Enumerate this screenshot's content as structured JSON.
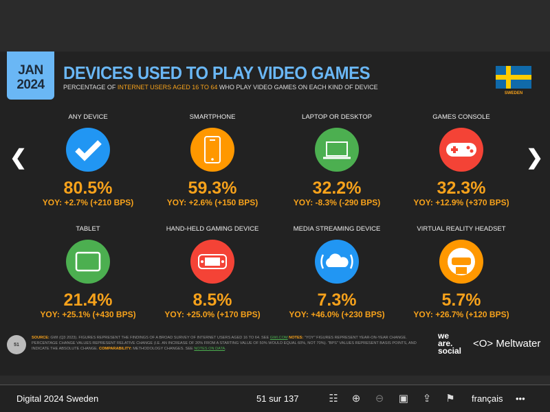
{
  "slide": {
    "date_month": "JAN",
    "date_year": "2024",
    "title": "DEVICES USED TO PLAY VIDEO GAMES",
    "subtitle_pre": "PERCENTAGE OF ",
    "subtitle_hl": "INTERNET USERS AGED 16 TO 64",
    "subtitle_post": " WHO PLAY VIDEO GAMES ON EACH KIND OF DEVICE",
    "country": "SWEDEN",
    "page_number": "51",
    "tiles": [
      {
        "label": "ANY DEVICE",
        "value": "80.5%",
        "yoy": "YOY: +2.7% (+210 BPS)",
        "icon": "check-icon",
        "color": "#2196f3"
      },
      {
        "label": "SMARTPHONE",
        "value": "59.3%",
        "yoy": "YOY: +2.6% (+150 BPS)",
        "icon": "smartphone-icon",
        "color": "#ff9800"
      },
      {
        "label": "LAPTOP OR DESKTOP",
        "value": "32.2%",
        "yoy": "YOY: -8.3% (-290 BPS)",
        "icon": "laptop-icon",
        "color": "#4caf50"
      },
      {
        "label": "GAMES CONSOLE",
        "value": "32.3%",
        "yoy": "YOY: +12.9% (+370 BPS)",
        "icon": "gamepad-icon",
        "color": "#f44336"
      },
      {
        "label": "TABLET",
        "value": "21.4%",
        "yoy": "YOY: +25.1% (+430 BPS)",
        "icon": "tablet-icon",
        "color": "#4caf50"
      },
      {
        "label": "HAND-HELD GAMING DEVICE",
        "value": "8.5%",
        "yoy": "YOY: +25.0% (+170 BPS)",
        "icon": "handheld-console-icon",
        "color": "#f44336"
      },
      {
        "label": "MEDIA STREAMING DEVICE",
        "value": "7.3%",
        "yoy": "YOY: +46.0% (+230 BPS)",
        "icon": "cloud-streaming-icon",
        "color": "#2196f3"
      },
      {
        "label": "VIRTUAL REALITY HEADSET",
        "value": "5.7%",
        "yoy": "YOY: +26.7% (+120 BPS)",
        "icon": "vr-headset-icon",
        "color": "#ff9800"
      }
    ],
    "footer": {
      "source_label": "SOURCE:",
      "source_text": " GWI (Q3 2023). FIGURES REPRESENT THE FINDINGS OF A BROAD SURVEY OF INTERNET USERS AGED 16 TO 64. SEE ",
      "gwi_link": "GWI.COM",
      "notes_label": " NOTES:",
      "notes_text": " \"YOY\" FIGURES REPRESENT YEAR-ON-YEAR CHANGE. PERCENTAGE CHANGE VALUES REPRESENT RELATIVE CHANGE (I.E. AN INCREASE OF 20% FROM A STARTING VALUE OF 50% WOULD EQUAL 60%, NOT 70%). \"BPS\" VALUES REPRESENT BASIS POINTS, AND INDICATE THE ABSOLUTE CHANGE.",
      "comp_label": " COMPARABILITY:",
      "comp_text": " METHODOLOGY CHANGES. SEE ",
      "notes_link": "NOTES ON DATA",
      "notes_end": ".",
      "brand1": "we are social",
      "brand2": "Meltwater"
    }
  },
  "viewer": {
    "doc_title": "Digital 2024 Sweden",
    "page_indicator": "51 sur 137",
    "language": "français",
    "more": "•••"
  }
}
